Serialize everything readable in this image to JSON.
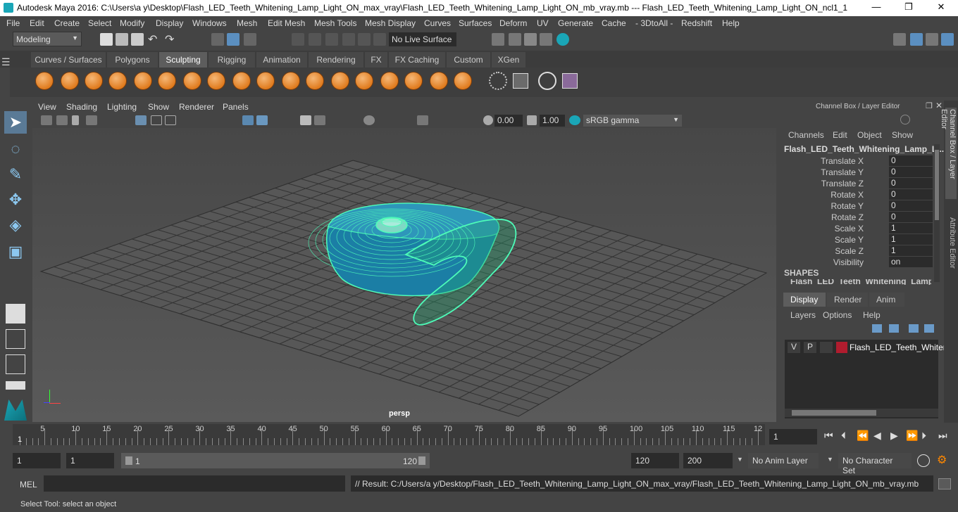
{
  "title": "Autodesk Maya 2016: C:\\Users\\a y\\Desktop\\Flash_LED_Teeth_Whitening_Lamp_Light_ON_max_vray\\Flash_LED_Teeth_Whitening_Lamp_Light_ON_mb_vray.mb    ---    Flash_LED_Teeth_Whitening_Lamp_Light_ON_ncl1_1",
  "window_controls": [
    "—",
    "❐",
    "✕"
  ],
  "menu": [
    "File",
    "Edit",
    "Create",
    "Select",
    "Modify",
    "Display",
    "Windows",
    "Mesh",
    "Edit Mesh",
    "Mesh Tools",
    "Mesh Display",
    "Curves",
    "Surfaces",
    "Deform",
    "UV",
    "Generate",
    "Cache",
    "- 3DtoAll -",
    "Redshift",
    "Help"
  ],
  "mode_select": "Modeling",
  "live_surface": "No Live Surface",
  "shelf_tabs": [
    "Curves / Surfaces",
    "Polygons",
    "Sculpting",
    "Rigging",
    "Animation",
    "Rendering",
    "FX",
    "FX Caching",
    "Custom",
    "XGen"
  ],
  "active_shelf_tab": "Sculpting",
  "viewport_menu": [
    "View",
    "Shading",
    "Lighting",
    "Show",
    "Renderer",
    "Panels"
  ],
  "viewport": {
    "exposure": "0.00",
    "gamma": "1.00",
    "color_space": "sRGB gamma",
    "camera_label": "persp"
  },
  "channel_box": {
    "header": "Channel Box / Layer Editor",
    "menu": [
      "Channels",
      "Edit",
      "Object",
      "Show"
    ],
    "object_name": "Flash_LED_Teeth_Whitening_Lamp_Li...",
    "attributes": [
      {
        "label": "Translate X",
        "value": "0"
      },
      {
        "label": "Translate Y",
        "value": "0"
      },
      {
        "label": "Translate Z",
        "value": "0"
      },
      {
        "label": "Rotate X",
        "value": "0"
      },
      {
        "label": "Rotate Y",
        "value": "0"
      },
      {
        "label": "Rotate Z",
        "value": "0"
      },
      {
        "label": "Scale X",
        "value": "1"
      },
      {
        "label": "Scale Y",
        "value": "1"
      },
      {
        "label": "Scale Z",
        "value": "1"
      },
      {
        "label": "Visibility",
        "value": "on"
      }
    ],
    "shapes_label": "SHAPES",
    "shapes_item": "Flash_LED_Teeth_Whitening_Lamp..."
  },
  "layer_editor": {
    "tabs": [
      "Display",
      "Render",
      "Anim"
    ],
    "active_tab": "Display",
    "menu": [
      "Layers",
      "Options",
      "Help"
    ],
    "layer": {
      "v": "V",
      "p": "P",
      "name": "Flash_LED_Teeth_Whiter",
      "color": "#b01c2e"
    }
  },
  "side_tabs": [
    "Channel Box / Layer Editor",
    "Attribute Editor"
  ],
  "timeline": {
    "ticks": [
      "5",
      "10",
      "15",
      "20",
      "25",
      "30",
      "35",
      "40",
      "45",
      "50",
      "55",
      "60",
      "65",
      "70",
      "75",
      "80",
      "85",
      "90",
      "95",
      "100",
      "105",
      "110",
      "115",
      "12"
    ],
    "start_marker": "1",
    "current_frame": "1"
  },
  "range": {
    "start": "1",
    "start2": "1",
    "slider_start": "1",
    "slider_end": "120",
    "end": "120",
    "end2": "200",
    "anim_layer": "No Anim Layer",
    "char_set": "No Character Set"
  },
  "mel": {
    "label": "MEL",
    "result": "// Result: C:/Users/a y/Desktop/Flash_LED_Teeth_Whitening_Lamp_Light_ON_max_vray/Flash_LED_Teeth_Whitening_Lamp_Light_ON_mb_vray.mb"
  },
  "status": "Select Tool: select an object"
}
